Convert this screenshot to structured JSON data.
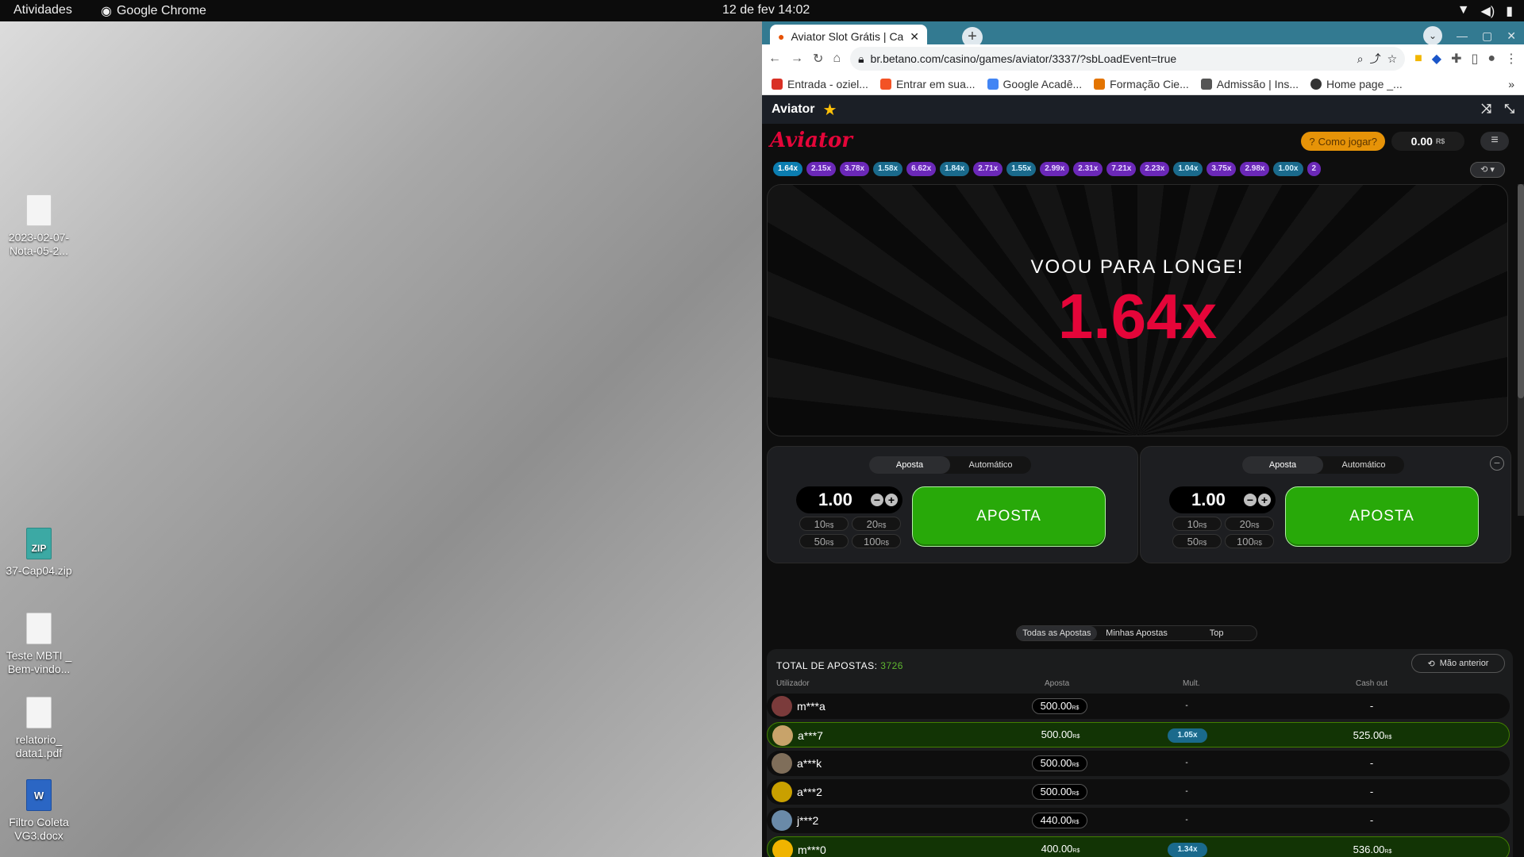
{
  "topbar": {
    "activities": "Atividades",
    "app": "Google Chrome",
    "clock": "12 de fev  14:02"
  },
  "desktop": {
    "icons": [
      {
        "label": "2023-02-07-Nota-05-2...",
        "kind": "file"
      },
      {
        "label": "37-Cap04.zip",
        "kind": "zip",
        "badge": "ZIP"
      },
      {
        "label": "Teste MBTI _ Bem-vindo...",
        "kind": "file"
      },
      {
        "label": "relatorio_ data1.pdf",
        "kind": "file"
      },
      {
        "label": "Filtro Coleta VG3.docx",
        "kind": "doc",
        "badge": "W"
      }
    ]
  },
  "browser": {
    "tab_title": "Aviator Slot Grátis | Cassi",
    "url": "br.betano.com/casino/games/aviator/3337/?sbLoadEvent=true",
    "bookmarks": [
      "Entrada - oziel...",
      "Entrar em sua...",
      "Google Acadê...",
      "Formação Cie...",
      "Admissão | Ins...",
      "Home page _..."
    ],
    "bookmarks_more": "»"
  },
  "site": {
    "title": "Aviator"
  },
  "game": {
    "logo": "Aviator",
    "how_to_play": "Como jogar?",
    "balance": "0.00",
    "currency": "R$",
    "history": [
      {
        "v": "1.64x",
        "c": "first"
      },
      {
        "v": "2.15x",
        "c": "purple"
      },
      {
        "v": "3.78x",
        "c": "purple"
      },
      {
        "v": "1.58x",
        "c": "blue"
      },
      {
        "v": "6.62x",
        "c": "purple"
      },
      {
        "v": "1.84x",
        "c": "blue"
      },
      {
        "v": "2.71x",
        "c": "purple"
      },
      {
        "v": "1.55x",
        "c": "blue"
      },
      {
        "v": "2.99x",
        "c": "purple"
      },
      {
        "v": "2.31x",
        "c": "purple"
      },
      {
        "v": "7.21x",
        "c": "purple"
      },
      {
        "v": "2.23x",
        "c": "purple"
      },
      {
        "v": "1.04x",
        "c": "blue"
      },
      {
        "v": "3.75x",
        "c": "purple"
      },
      {
        "v": "2.98x",
        "c": "purple"
      },
      {
        "v": "1.00x",
        "c": "blue"
      },
      {
        "v": "2",
        "c": "purple"
      }
    ],
    "flew_away": "VOOU PARA LONGE!",
    "multiplier": "1.64x",
    "panels": [
      {
        "tab_bet": "Aposta",
        "tab_auto": "Automático",
        "amount": "1.00",
        "quick": [
          "10",
          "20",
          "50",
          "100"
        ],
        "button": "APOSTA"
      },
      {
        "tab_bet": "Aposta",
        "tab_auto": "Automático",
        "amount": "1.00",
        "quick": [
          "10",
          "20",
          "50",
          "100"
        ],
        "button": "APOSTA"
      }
    ],
    "bet_tabs": [
      "Todas as Apostas",
      "Minhas Apostas",
      "Top"
    ],
    "total_label": "TOTAL DE APOSTAS:",
    "total_value": "3726",
    "prev_hand": "Mão anterior",
    "columns": [
      "Utilizador",
      "Aposta",
      "Mult.",
      "Cash out"
    ],
    "rows": [
      {
        "user": "m***a",
        "bet": "500.00",
        "mult": "-",
        "cashout": "-",
        "win": false
      },
      {
        "user": "a***7",
        "bet": "500.00",
        "mult": "1.05x",
        "cashout": "525.00",
        "win": true
      },
      {
        "user": "a***k",
        "bet": "500.00",
        "mult": "-",
        "cashout": "-",
        "win": false
      },
      {
        "user": "a***2",
        "bet": "500.00",
        "mult": "-",
        "cashout": "-",
        "win": false
      },
      {
        "user": "j***2",
        "bet": "440.00",
        "mult": "-",
        "cashout": "-",
        "win": false
      },
      {
        "user": "m***0",
        "bet": "400.00",
        "mult": "1.34x",
        "cashout": "536.00",
        "win": true
      }
    ]
  }
}
